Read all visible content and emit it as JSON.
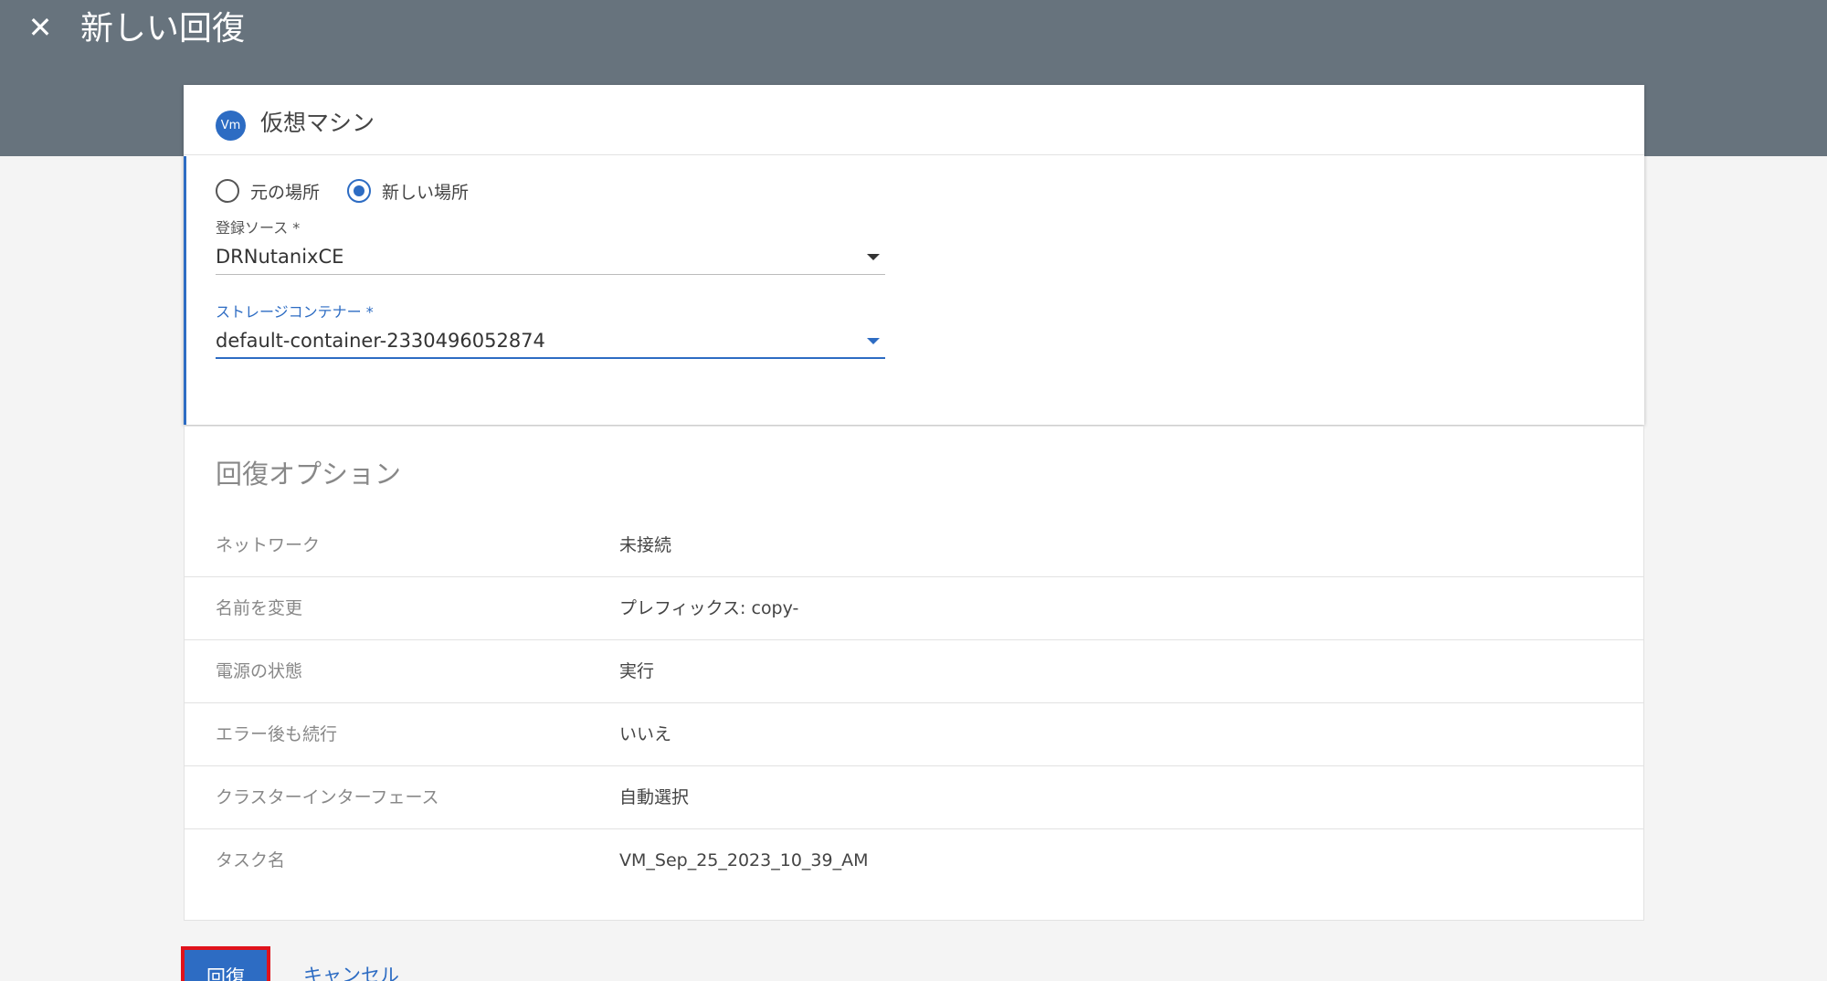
{
  "header": {
    "title": "新しい回復",
    "close_icon": "close-icon"
  },
  "vm_card": {
    "badge": "Vm",
    "title": "仮想マシン",
    "radio_options": [
      {
        "label": "元の場所",
        "checked": false
      },
      {
        "label": "新しい場所",
        "checked": true
      }
    ],
    "registration_source": {
      "label": "登録ソース *",
      "value": "DRNutanixCE"
    },
    "storage_container": {
      "label": "ストレージコンテナー *",
      "value": "default-container-2330496052874"
    }
  },
  "recovery_options": {
    "title": "回復オプション",
    "rows": [
      {
        "key": "ネットワーク",
        "value": "未接続"
      },
      {
        "key": "名前を変更",
        "value": "プレフィックス: copy-"
      },
      {
        "key": "電源の状態",
        "value": "実行"
      },
      {
        "key": "エラー後も続行",
        "value": "いいえ"
      },
      {
        "key": "クラスターインターフェース",
        "value": "自動選択"
      },
      {
        "key": "タスク名",
        "value": "VM_Sep_25_2023_10_39_AM"
      }
    ]
  },
  "actions": {
    "recover_label": "回復",
    "cancel_label": "キャンセル"
  },
  "colors": {
    "header_bg": "#67737d",
    "accent": "#2d6cc3",
    "highlight_border": "#e0121b"
  }
}
